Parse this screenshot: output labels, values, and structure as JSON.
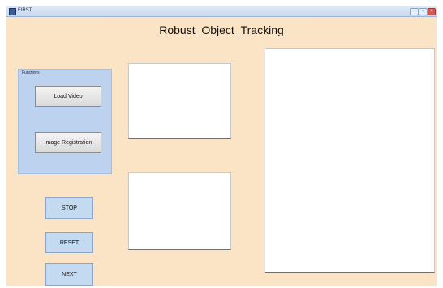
{
  "window": {
    "title": "FIRST",
    "controls": {
      "minimize": "–",
      "maximize": "▫",
      "close": "×"
    }
  },
  "main_title": "Robust_Object_Tracking",
  "functions_panel": {
    "label": "Functions",
    "buttons": {
      "load_video": "Load Video",
      "image_registration": "Image Registration"
    }
  },
  "controls": {
    "stop": "STOP",
    "reset": "RESET",
    "next": "NEXT"
  },
  "colors": {
    "background": "#fbe4c6",
    "panel": "#bdd2ee",
    "control_button": "#c4daf1",
    "axes": "#ffffff"
  }
}
